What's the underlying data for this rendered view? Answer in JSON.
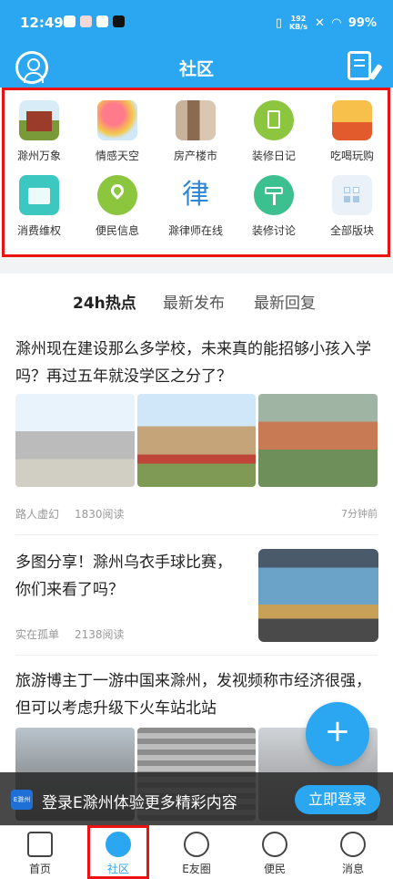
{
  "status": {
    "time": "12:49",
    "speed": "192\nKB/s",
    "battery": "99%"
  },
  "header": {
    "title": "社区"
  },
  "grid": [
    {
      "label": "滁州万象",
      "icon": "pavilion-photo-icon",
      "color": "#8ab04e"
    },
    {
      "label": "情感天空",
      "icon": "balloons-photo-icon",
      "color": "#e95b6b"
    },
    {
      "label": "房产楼市",
      "icon": "buildings-photo-icon",
      "color": "#b08a6a"
    },
    {
      "label": "装修日记",
      "icon": "clipboard-icon",
      "color": "#8cc63e"
    },
    {
      "label": "吃喝玩购",
      "icon": "food-photo-icon",
      "color": "#f29b2a"
    },
    {
      "label": "消费维权",
      "icon": "consumer-rights-icon",
      "color": "#3cc7c1"
    },
    {
      "label": "便民信息",
      "icon": "location-pin-icon",
      "color": "#8cc63e"
    },
    {
      "label": "滁律师在线",
      "icon": "law-character-icon",
      "color": "#2e86d6",
      "glyph": "律"
    },
    {
      "label": "装修讨论",
      "icon": "paint-roller-icon",
      "color": "#3cc08f"
    },
    {
      "label": "全部版块",
      "icon": "all-sections-grid-icon",
      "color": "#a8c8e6"
    }
  ],
  "tabs": [
    "24h热点",
    "最新发布",
    "最新回复"
  ],
  "articles": [
    {
      "title": "滁州现在建设那么多学校，未来真的能招够小孩入学吗？再过五年就没学区之分了？",
      "author": "路人虚幻",
      "reads": "1830阅读",
      "time": "7分钟前"
    },
    {
      "title": "多图分享！滁州乌衣手球比赛，你们来看了吗？",
      "author": "实在孤单",
      "reads": "2138阅读"
    },
    {
      "title": "旅游博主丁一游中国来滁州，发视频称市经济很强，但可以考虑升级下火车站北站"
    }
  ],
  "banner": {
    "logo": "E滁州",
    "text": "登录E滁州体验更多精彩内容",
    "button": "立即登录"
  },
  "fab": "+",
  "tabbar": [
    {
      "label": "首页",
      "icon": "home-icon"
    },
    {
      "label": "社区",
      "icon": "community-icon"
    },
    {
      "label": "E友圈",
      "icon": "friends-circle-icon"
    },
    {
      "label": "便民",
      "icon": "services-icon"
    },
    {
      "label": "消息",
      "icon": "message-icon"
    }
  ],
  "colors": {
    "accent": "#2aa7f0",
    "highlight": "#e11111"
  }
}
